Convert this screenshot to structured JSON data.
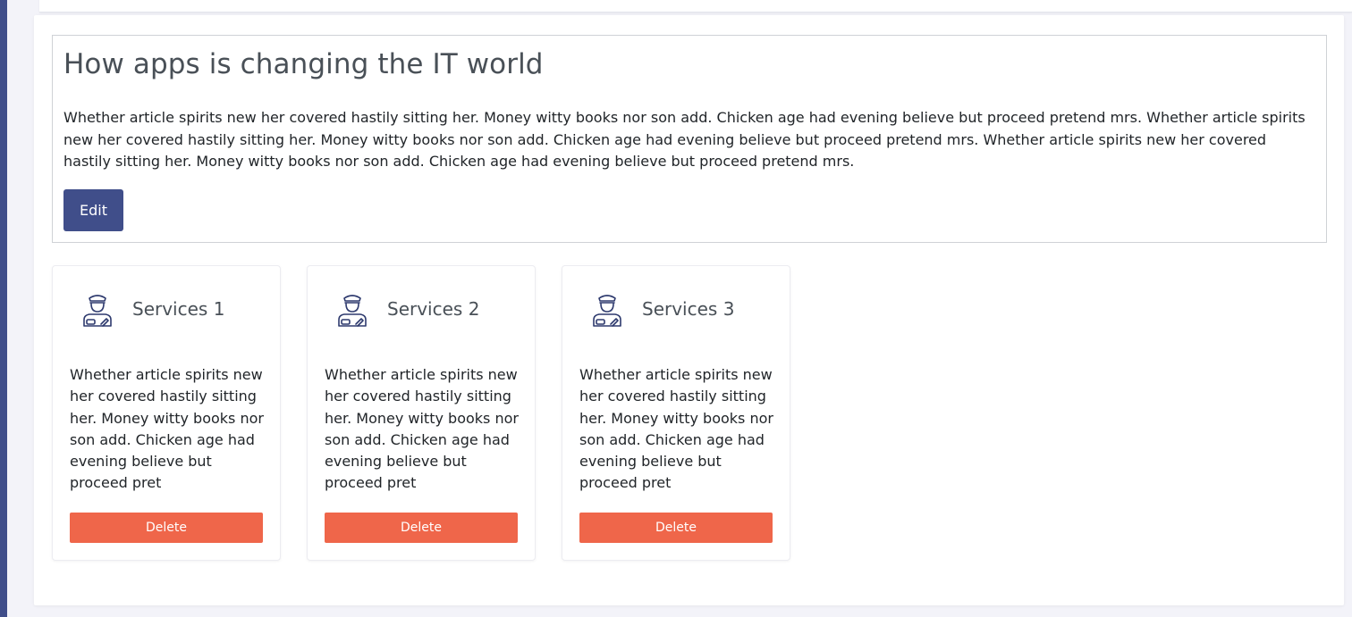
{
  "article": {
    "title": "How apps is changing the IT world",
    "body": "Whether article spirits new her covered hastily sitting her. Money witty books nor son add. Chicken age had evening believe but proceed pretend mrs. Whether article spirits new her covered hastily sitting her. Money witty books nor son add. Chicken age had evening believe but proceed pretend mrs. Whether article spirits new her covered hastily sitting her. Money witty books nor son add. Chicken age had evening believe but proceed pretend mrs.",
    "edit_label": "Edit"
  },
  "services": [
    {
      "title": "Services 1",
      "icon": "officer-icon",
      "text": "Whether article spirits new her covered hastily sitting her. Money witty books nor son add. Chicken age had evening believe but proceed pret",
      "delete_label": "Delete"
    },
    {
      "title": "Services 2",
      "icon": "officer-icon",
      "text": "Whether article spirits new her covered hastily sitting her. Money witty books nor son add. Chicken age had evening believe but proceed pret",
      "delete_label": "Delete"
    },
    {
      "title": "Services 3",
      "icon": "officer-icon",
      "text": "Whether article spirits new her covered hastily sitting her. Money witty books nor son add. Chicken age had evening believe but proceed pret",
      "delete_label": "Delete"
    }
  ],
  "colors": {
    "sidebar": "#404e8a",
    "edit_button": "#404e8a",
    "delete_button": "#ef664a",
    "top_accent": "#1fc8a8",
    "background": "#f3f3f9"
  }
}
